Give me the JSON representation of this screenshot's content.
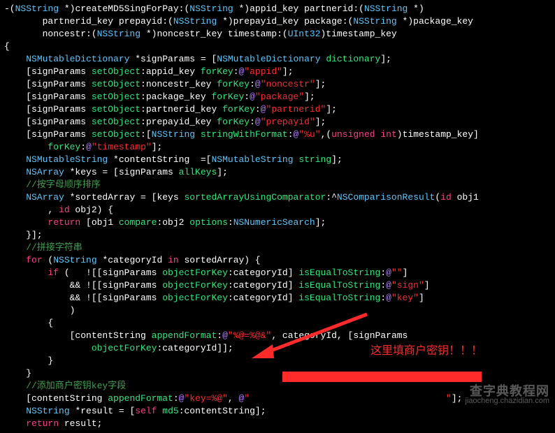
{
  "method_sig": {
    "l1a": "-(",
    "l1_type1": "NSString",
    "l1b": " *)",
    "l1_name": "createMD5SingForPay",
    "l1c": ":(",
    "l1_type2": "NSString",
    "l1d": " *)appid_key partnerid:(",
    "l1_type3": "NSString",
    "l1e": " *)",
    "l2a": "       partnerid_key prepayid:(",
    "l2_type1": "NSString",
    "l2b": " *)prepayid_key package:(",
    "l2_type2": "NSString",
    "l2c": " *)package_key",
    "l3a": "       noncestr:(",
    "l3_type1": "NSString",
    "l3b": " *)noncestr_key timestamp:(",
    "l3_type2": "UInt32",
    "l3c": ")timestamp_key"
  },
  "brace_open": "{",
  "signParams_decl": {
    "a": "    ",
    "type": "NSMutableDictionary",
    "b": " *signParams = [",
    "type2": "NSMutableDictionary",
    "c": " ",
    "msg": "dictionary",
    "d": "];"
  },
  "setobj": [
    {
      "a": "    [signParams ",
      "m1": "setObject",
      "b": ":appid_key ",
      "m2": "forKey",
      "c": ":",
      "at": "@",
      "s": "\"appid\"",
      "d": "];"
    },
    {
      "a": "    [signParams ",
      "m1": "setObject",
      "b": ":noncestr_key ",
      "m2": "forKey",
      "c": ":",
      "at": "@",
      "s": "\"noncestr\"",
      "d": "];"
    },
    {
      "a": "    [signParams ",
      "m1": "setObject",
      "b": ":package_key ",
      "m2": "forKey",
      "c": ":",
      "at": "@",
      "s": "\"package\"",
      "d": "];"
    },
    {
      "a": "    [signParams ",
      "m1": "setObject",
      "b": ":partnerid_key ",
      "m2": "forKey",
      "c": ":",
      "at": "@",
      "s": "\"partnerid\"",
      "d": "];"
    },
    {
      "a": "    [signParams ",
      "m1": "setObject",
      "b": ":prepayid_key ",
      "m2": "forKey",
      "c": ":",
      "at": "@",
      "s": "\"prepayid\"",
      "d": "];"
    }
  ],
  "setobj_ts": {
    "a": "    [signParams ",
    "m1": "setObject",
    "b": ":[",
    "type": "NSString",
    "c": " ",
    "m2": "stringWithFormat",
    "d": ":",
    "at1": "@",
    "s1": "\"%u\"",
    "e": ",(",
    "kw": "unsigned int",
    "f": ")timestamp_key]",
    "l2a": "        ",
    "m3": "forKey",
    "l2b": ":",
    "at2": "@",
    "s2": "\"timestamp\"",
    "l2c": "];"
  },
  "contentString_decl": {
    "a": "    ",
    "type": "NSMutableString",
    "b": " *contentString  =[",
    "type2": "NSMutableString",
    "c": " ",
    "msg": "string",
    "d": "];"
  },
  "keys_decl": {
    "a": "    ",
    "type": "NSArray",
    "b": " *keys = [signParams ",
    "msg": "allKeys",
    "c": "];"
  },
  "comment1": "    //按字母顺序排序",
  "sortedArray_decl": {
    "a": "    ",
    "type1": "NSArray",
    "b": " *sortedArray = [keys ",
    "msg": "sortedArrayUsingComparator",
    "c": ":^",
    "type2": "NSComparisonResult",
    "d": "(",
    "kw1": "id",
    "e": " obj1",
    "l2a": "        , ",
    "kw2": "id",
    "l2b": " obj2) {",
    "l3a": "        ",
    "kw3": "return",
    "l3b": " [obj1 ",
    "m1": "compare",
    "l3c": ":obj2 ",
    "m2": "options",
    "l3d": ":",
    "enum": "NSNumericSearch",
    "l3e": "];",
    "l4": "    }];"
  },
  "comment2": "    //拼接字符串",
  "forloop": {
    "l1a": "    ",
    "kw_for": "for",
    "l1b": " (",
    "type": "NSString",
    "l1c": " *categoryId ",
    "kw_in": "in",
    "l1d": " sortedArray) {",
    "if1a": "        ",
    "kw_if": "if",
    "if1b": " (   ![[signParams ",
    "m1": "objectForKey",
    "if1c": ":categoryId] ",
    "m2": "isEqualToString",
    "if1d": ":",
    "at1": "@",
    "s1": "\"\"",
    "if1e": "]",
    "if2a": "            && ![[signParams ",
    "m3": "objectForKey",
    "if2b": ":categoryId] ",
    "m4": "isEqualToString",
    "if2c": ":",
    "at2": "@",
    "s2": "\"sign\"",
    "if2d": "]",
    "if3a": "            && ![[signParams ",
    "m5": "objectForKey",
    "if3b": ":categoryId] ",
    "m6": "isEqualToString",
    "if3c": ":",
    "at3": "@",
    "s3": "\"key\"",
    "if3d": "]",
    "if4": "            )",
    "ob": "        {",
    "ap1a": "            [contentString ",
    "apm": "appendFormat",
    "ap1b": ":",
    "apat": "@",
    "aps": "\"%@=%@&\"",
    "ap1c": ", categoryId, [signParams",
    "ap2a": "                ",
    "apm2": "objectForKey",
    "ap2b": ":categoryId]];",
    "cb": "        }",
    "fb": "    }"
  },
  "comment3": "    //添加商户密钥key字段",
  "appendKey": {
    "a": "    [contentString ",
    "m": "appendFormat",
    "b": ":",
    "at1": "@",
    "s1": "\"key=%@\"",
    "c": ", ",
    "at2": "@",
    "s2": "\"",
    "d": "];"
  },
  "result_decl": {
    "a": "    ",
    "type": "NSString",
    "b": " *result = [",
    "kw": "self",
    "c": " ",
    "msg": "md5",
    "d": ":contentString];"
  },
  "return_line": {
    "a": "    ",
    "kw": "return",
    "b": " result;"
  },
  "callout": "这里填商户密钥！！！",
  "watermark": {
    "line1": "查字典教程网",
    "line2": "jiaocheng.chazidian.com"
  }
}
